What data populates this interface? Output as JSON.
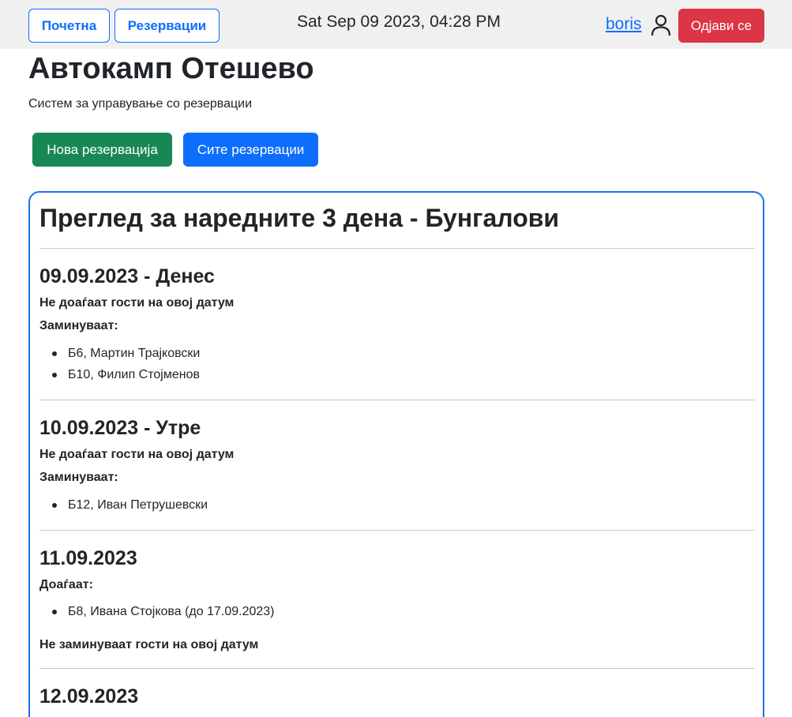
{
  "nav": {
    "home_label": "Почетна",
    "reservations_label": "Резервации",
    "datetime": "Sat Sep 09 2023, 04:28 PM",
    "username": "boris",
    "user_icon": "user-icon",
    "logout_label": "Одјави се"
  },
  "header": {
    "title": "Автокамп Отешево",
    "subtitle": "Систем за управување со резервации"
  },
  "actions": {
    "new_label": "Нова резервација",
    "all_label": "Сите резервации"
  },
  "overview": {
    "title": "Преглед за наредните 3 дена - Бунгалови",
    "days": [
      {
        "date_title": "09.09.2023 - Денес",
        "arrivals_text": "Не доаѓаат гости на овој датум",
        "departures_label": "Заминуваат:",
        "departures": [
          "Б6, Мартин Трајковски",
          "Б10, Филип Стојменов"
        ]
      },
      {
        "date_title": "10.09.2023 - Утре",
        "arrivals_text": "Не доаѓаат гости на овој датум",
        "departures_label": "Заминуваат:",
        "departures": [
          "Б12, Иван Петрушевски"
        ]
      },
      {
        "date_title": "11.09.2023",
        "arrivals_label": "Доаѓаат:",
        "arrivals": [
          "Б8, Ивана Стојкова (до 17.09.2023)"
        ],
        "departures_text": "Не заминуваат гости на овој датум"
      },
      {
        "date_title": "12.09.2023"
      }
    ]
  },
  "colors": {
    "primary": "#0d6efd",
    "success": "#198754",
    "danger": "#dc3545",
    "panel_border": "#1a73e8",
    "topbar_bg": "#f0f0f0"
  }
}
